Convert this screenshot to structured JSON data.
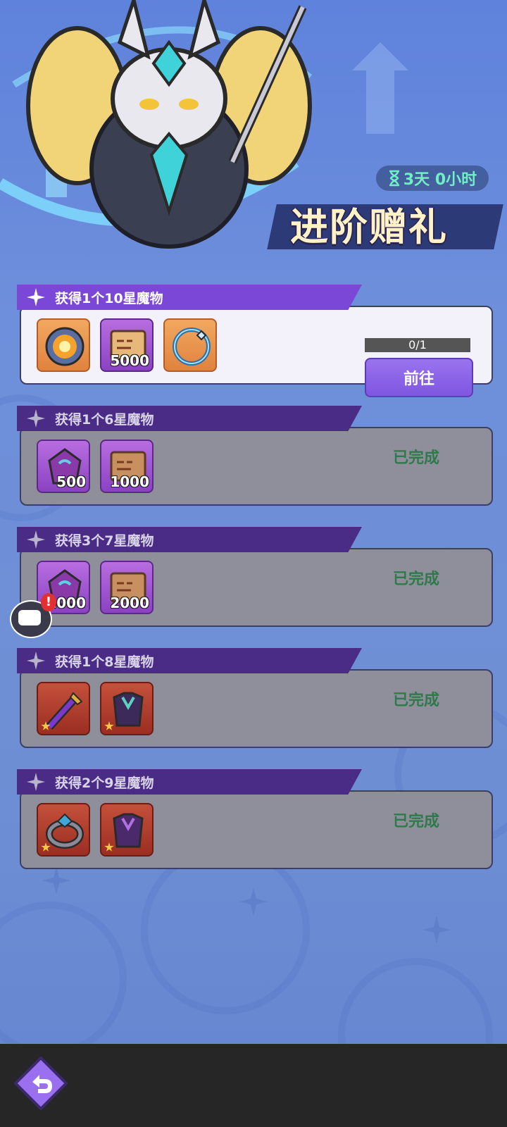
{
  "banner": {
    "timer": "3天 0小时",
    "title": "进阶赠礼"
  },
  "tasks": [
    {
      "label": "获得1个10星魔物",
      "state": "active",
      "progress": "0/1",
      "action": "前往",
      "rewards": [
        {
          "icon": "fire-orb-icon",
          "frame": "orange",
          "qty": ""
        },
        {
          "icon": "scroll-icon",
          "frame": "purple",
          "qty": "5000"
        },
        {
          "icon": "ring-icon",
          "frame": "orange",
          "qty": ""
        }
      ]
    },
    {
      "label": "获得1个6星魔物",
      "state": "done",
      "status": "已完成",
      "rewards": [
        {
          "icon": "gem-icon",
          "frame": "purple",
          "qty": "500"
        },
        {
          "icon": "scroll-icon",
          "frame": "purple",
          "qty": "1000"
        }
      ]
    },
    {
      "label": "获得3个7星魔物",
      "state": "done",
      "status": "已完成",
      "rewards": [
        {
          "icon": "gem-icon",
          "frame": "purple",
          "qty": "1000"
        },
        {
          "icon": "scroll-icon",
          "frame": "purple",
          "qty": "2000"
        }
      ]
    },
    {
      "label": "获得1个8星魔物",
      "state": "done",
      "status": "已完成",
      "rewards": [
        {
          "icon": "sword-icon",
          "frame": "red",
          "qty": ""
        },
        {
          "icon": "armor-icon",
          "frame": "red",
          "qty": ""
        }
      ]
    },
    {
      "label": "获得2个9星魔物",
      "state": "done",
      "status": "已完成",
      "rewards": [
        {
          "icon": "ring-icon",
          "frame": "red",
          "qty": ""
        },
        {
          "icon": "armor-icon",
          "frame": "red",
          "qty": ""
        }
      ]
    }
  ],
  "chat": {
    "badge": "!"
  },
  "colors": {
    "accent": "#7f56e0",
    "done_text": "#2f7a4a",
    "timer_text": "#6ff0c4"
  }
}
